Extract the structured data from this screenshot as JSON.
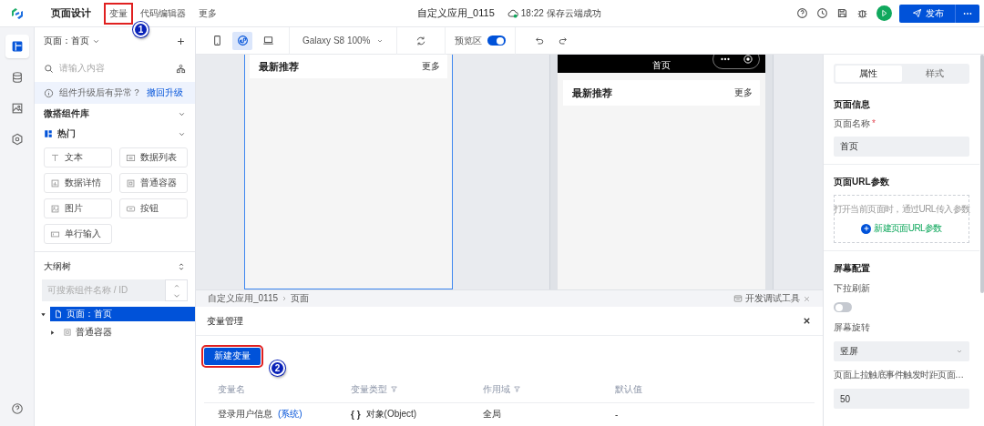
{
  "rail": {
    "items": [
      {
        "kind": "pages",
        "selected": true
      },
      {
        "kind": "data",
        "selected": false
      },
      {
        "kind": "media",
        "selected": false
      },
      {
        "kind": "settings",
        "selected": false
      }
    ]
  },
  "top_bar": {
    "tabs": [
      {
        "label": "页面设计",
        "selected": true
      },
      {
        "label": "变量",
        "selected": false,
        "annotation": "1"
      },
      {
        "label": "代码编辑器",
        "selected": false
      },
      {
        "label": "更多",
        "selected": false
      }
    ],
    "app_name": "自定义应用_0115",
    "save_status": "18:22 保存云端成功",
    "publish_label": "发布"
  },
  "left_panel": {
    "page_selector": "页面：首页",
    "search_placeholder": "请输入内容",
    "notice": "组件升级后有异常？",
    "notice_link": "撤回升级",
    "library_title": "微搭组件库",
    "category": "热门",
    "components": [
      {
        "label": "文本",
        "kind": "text"
      },
      {
        "label": "数据列表",
        "kind": "list"
      },
      {
        "label": "数据详情",
        "kind": "detail"
      },
      {
        "label": "普通容器",
        "kind": "container"
      },
      {
        "label": "图片",
        "kind": "image"
      },
      {
        "label": "按钮",
        "kind": "button"
      },
      {
        "label": "单行输入",
        "kind": "input"
      }
    ],
    "outline_title": "大纲树",
    "outline_search_placeholder": "可搜索组件名称 / ID",
    "tree": [
      {
        "label": "页面：首页",
        "kind": "page",
        "selected": true,
        "expanded": true,
        "children": [
          {
            "label": "普通容器",
            "kind": "container",
            "selected": false,
            "expanded": false
          }
        ]
      }
    ]
  },
  "toolbar": {
    "devices": [
      {
        "kind": "phone",
        "selected": false
      },
      {
        "kind": "mini-program",
        "selected": true
      },
      {
        "kind": "desktop",
        "selected": false
      }
    ],
    "device_select": "Galaxy S8 100%",
    "preview_label": "预览区",
    "preview_on": true
  },
  "canvas": {
    "editor": {
      "title": "最新推荐",
      "more": "更多"
    },
    "preview": {
      "nav_title": "首页",
      "title": "最新推荐",
      "more": "更多"
    }
  },
  "bottom_panel": {
    "breadcrumb": [
      "自定义应用_0115",
      "页面"
    ],
    "devtools": "开发调试工具",
    "title": "变量管理",
    "new_button": {
      "label": "新建变量",
      "annotation": "2"
    },
    "columns": [
      {
        "label": "变量名",
        "filter": false
      },
      {
        "label": "变量类型",
        "filter": true
      },
      {
        "label": "作用域",
        "filter": true
      },
      {
        "label": "默认值",
        "filter": false
      }
    ],
    "rows": [
      {
        "name": "登录用户信息",
        "tag": "(系统)",
        "type_icon": "{ }",
        "type": "对象(Object)",
        "scope": "全局",
        "default": "-"
      }
    ]
  },
  "right_panel": {
    "tabs": [
      {
        "label": "属性",
        "selected": true
      },
      {
        "label": "样式",
        "selected": false
      }
    ],
    "page_info_title": "页面信息",
    "page_name_label": "页面名称",
    "required_mark": "*",
    "page_name_value": "首页",
    "url_title": "页面URL参数",
    "url_hint": "打开当前页面时，通过URL传入参数",
    "url_add": "新建页面URL参数",
    "screen_title": "屏幕配置",
    "pull_refresh_label": "下拉刷新",
    "pull_refresh_on": false,
    "rotation_label": "屏幕旋转",
    "rotation_value": "竖屏",
    "reach_bottom_label": "页面上拉触底事件触发时距页面…",
    "reach_bottom_value": "50"
  }
}
